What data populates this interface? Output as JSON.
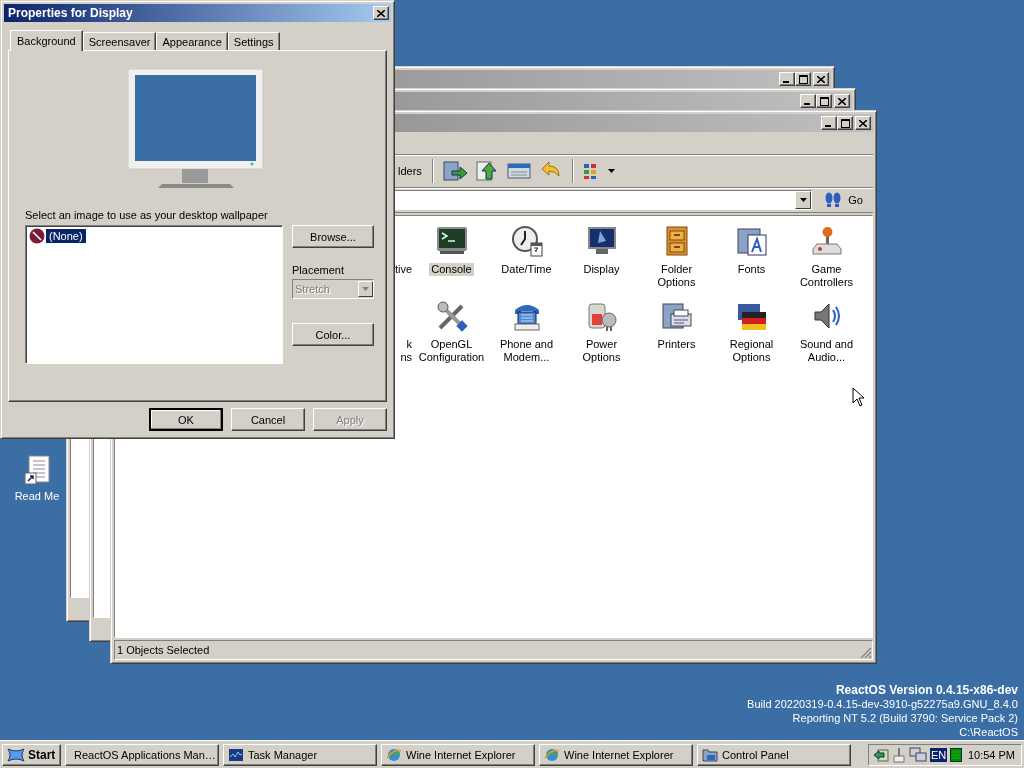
{
  "desktop": {
    "icons": [
      {
        "label": "Read Me"
      }
    ],
    "version_title": "ReactOS Version 0.4.15-x86-dev",
    "version_lines": [
      "Build 20220319-0.4.15-dev-3910-g52275a9.GNU_8.4.0",
      "Reporting NT 5.2 (Build 3790: Service Pack 2)",
      "C:\\ReactOS"
    ]
  },
  "control_panel": {
    "toolbar_label": "lders",
    "go": "Go",
    "items": [
      {
        "kind": "partial",
        "label": "tive",
        "selected": false
      },
      {
        "kind": "applet",
        "label": "Console",
        "selected": true
      },
      {
        "kind": "applet",
        "label": "Date/Time",
        "selected": false
      },
      {
        "kind": "applet",
        "label": "Display",
        "selected": false
      },
      {
        "kind": "applet",
        "label": "Folder Options",
        "selected": false
      },
      {
        "kind": "applet",
        "label": "Fonts",
        "selected": false
      },
      {
        "kind": "applet",
        "label": "Game Controllers",
        "selected": false
      },
      {
        "kind": "partial",
        "label": "k\nns",
        "selected": false
      },
      {
        "kind": "applet",
        "label": "OpenGL Configuration",
        "selected": false
      },
      {
        "kind": "applet",
        "label": "Phone and Modem...",
        "selected": false
      },
      {
        "kind": "applet",
        "label": "Power Options",
        "selected": false
      },
      {
        "kind": "applet",
        "label": "Printers",
        "selected": false
      },
      {
        "kind": "applet",
        "label": "Regional Options",
        "selected": false
      },
      {
        "kind": "applet",
        "label": "Sound and Audio...",
        "selected": false
      }
    ],
    "status": "1 Objects Selected"
  },
  "dialog": {
    "title": "Properties for Display",
    "tabs": [
      {
        "label": "Background",
        "selected": true
      },
      {
        "label": "Screensaver",
        "selected": false
      },
      {
        "label": "Appearance",
        "selected": false
      },
      {
        "label": "Settings",
        "selected": false
      }
    ],
    "prompt": "Select an image to use as your desktop wallpaper",
    "wallpapers": [
      {
        "label": "(None)",
        "selected": true
      }
    ],
    "browse": "Browse...",
    "placement_label": "Placement",
    "placement": {
      "value": "Stretch",
      "disabled": true
    },
    "color_button": "Color...",
    "buttons": [
      {
        "label": "OK",
        "disabled": false,
        "default": true
      },
      {
        "label": "Cancel",
        "disabled": false,
        "default": false
      },
      {
        "label": "Apply",
        "disabled": true,
        "default": false
      }
    ]
  },
  "taskbar": {
    "start": "Start",
    "tasks": [
      {
        "label": "ReactOS Applications Man…"
      },
      {
        "label": "Task Manager"
      },
      {
        "label": "Wine Internet Explorer"
      },
      {
        "label": "Wine Internet Explorer"
      },
      {
        "label": "Control Panel"
      }
    ],
    "language": "EN",
    "clock": "10:54 PM"
  }
}
